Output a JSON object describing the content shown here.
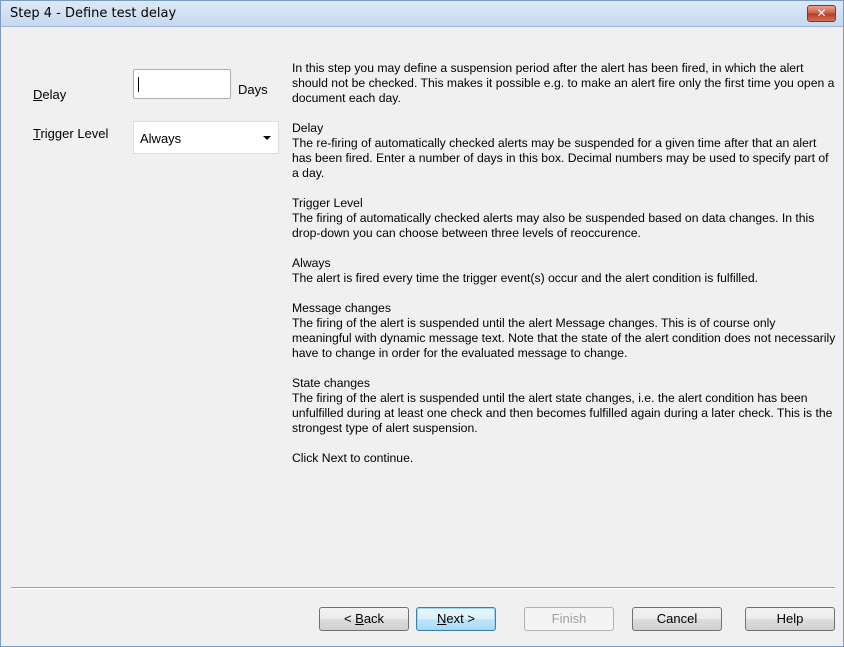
{
  "window": {
    "title": "Step 4 - Define test delay",
    "close_glyph": "✕"
  },
  "form": {
    "delay_label_accel": "D",
    "delay_label_rest": "elay",
    "delay_value": "",
    "days_label": "Days",
    "trigger_label_accel": "T",
    "trigger_label_rest": "rigger Level",
    "trigger_selected": "Always"
  },
  "help": {
    "paragraphs": [
      "In this step you may define a suspension period after the alert has been fired, in which the alert should not be checked. This makes it possible e.g. to make an alert fire only the first time you open a document each day.",
      "Delay\nThe re-firing of automatically checked alerts may be suspended for a given time after that an alert has been fired. Enter a number of days in this box. Decimal numbers may be used to specify part of a day.",
      "Trigger Level\nThe firing of automatically checked alerts may also be suspended based on data changes. In this drop-down you can choose between three levels of reoccurence.",
      "Always\nThe alert is fired every time the trigger event(s) occur and the alert condition is fulfilled.",
      "Message changes\nThe firing of the alert is suspended until the alert Message changes. This is of course only meaningful with dynamic message text. Note that the state of the alert condition does not necessarily have to change in order for the evaluated message to change.",
      "State changes\nThe firing of the alert is suspended until the alert state changes, i.e. the alert condition has been unfulfilled during at least one check and then becomes fulfilled again during a later check. This is the strongest type of alert suspension.",
      "Click Next to continue."
    ]
  },
  "buttons": {
    "back_prefix": "< ",
    "back_accel": "B",
    "back_rest": "ack",
    "next_accel": "N",
    "next_rest": "ext >",
    "finish": "Finish",
    "cancel": "Cancel",
    "help": "Help"
  }
}
